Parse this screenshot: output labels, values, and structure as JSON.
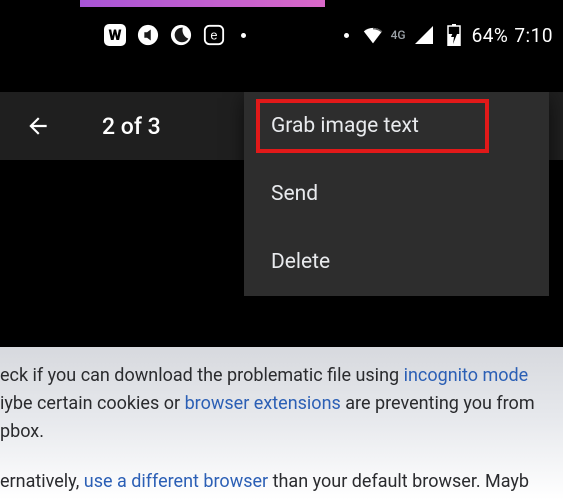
{
  "status_bar": {
    "app_w": "W",
    "network_label": "4G",
    "battery_percent": "64%",
    "time": "7:10"
  },
  "app_bar": {
    "counter": "2 of 3"
  },
  "menu": {
    "items": [
      {
        "label": "Grab image text",
        "highlighted": true
      },
      {
        "label": "Send",
        "highlighted": false
      },
      {
        "label": "Delete",
        "highlighted": false
      }
    ]
  },
  "photo_text": {
    "p1_a": "eck if you can download the problematic file using ",
    "p1_b": "incognito mode",
    "p1_c": "iybe certain cookies or ",
    "p1_d": "browser extensions",
    "p1_e": " are preventing you from",
    "p1_f": "pbox.",
    "p2_a": "ernatively, ",
    "p2_b": "use a different browser",
    "p2_c": " than your default browser. Mayb"
  }
}
